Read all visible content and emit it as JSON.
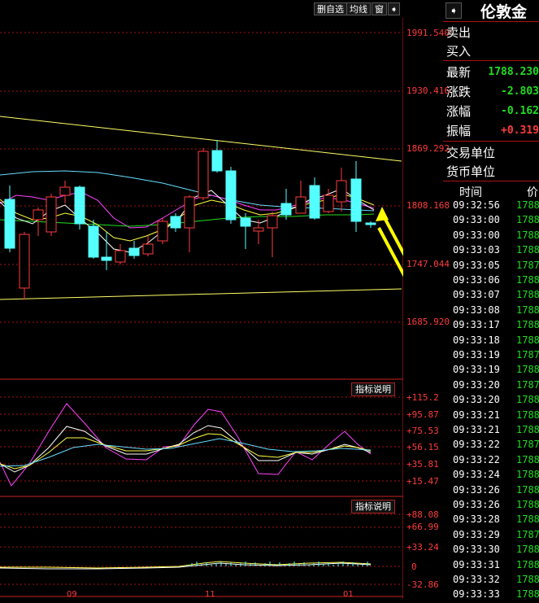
{
  "toolbar": {
    "delete_watch_label": "删自选",
    "ma_label": "均线",
    "window_label": "窗"
  },
  "main_chart": {
    "y_labels": [
      "1991.540",
      "1930.416",
      "1869.292",
      "1808.168",
      "1747.044",
      "1685.920"
    ]
  },
  "indicator1": {
    "button_label": "指标说明",
    "y_labels": [
      "+115.2",
      "+95.87",
      "+75.53",
      "+56.15",
      "+35.81",
      "+15.47"
    ]
  },
  "indicator2": {
    "button_label": "指标说明",
    "y_labels": [
      "+88.08",
      "+66.99",
      "+33.24",
      "0",
      "-32.86"
    ]
  },
  "x_axis": {
    "labels": [
      "09",
      "11",
      "01"
    ]
  },
  "panel": {
    "title": "伦敦金",
    "sell_label": "卖出",
    "buy_label": "买入",
    "latest_label": "最新",
    "latest_value": "1788.230",
    "change_label": "涨跌",
    "change_value": "-2.803",
    "change_pct_label": "涨幅",
    "change_pct_value": "-0.162",
    "amplitude_label": "振幅",
    "amplitude_value": "+0.319",
    "trade_unit_label": "交易单位",
    "currency_unit_label": "货币单位",
    "time_header": "时间",
    "price_header": "价"
  },
  "trades": [
    {
      "time": "09:32:56",
      "price": "1788"
    },
    {
      "time": "09:33:00",
      "price": "1788"
    },
    {
      "time": "09:33:00",
      "price": "1788"
    },
    {
      "time": "09:33:03",
      "price": "1788"
    },
    {
      "time": "09:33:05",
      "price": "1787"
    },
    {
      "time": "09:33:06",
      "price": "1788"
    },
    {
      "time": "09:33:07",
      "price": "1788"
    },
    {
      "time": "09:33:08",
      "price": "1788"
    },
    {
      "time": "09:33:17",
      "price": "1788"
    },
    {
      "time": "09:33:18",
      "price": "1788"
    },
    {
      "time": "09:33:19",
      "price": "1787"
    },
    {
      "time": "09:33:19",
      "price": "1788"
    },
    {
      "time": "09:33:20",
      "price": "1787"
    },
    {
      "time": "09:33:20",
      "price": "1788"
    },
    {
      "time": "09:33:21",
      "price": "1788"
    },
    {
      "time": "09:33:21",
      "price": "1788"
    },
    {
      "time": "09:33:22",
      "price": "1787"
    },
    {
      "time": "09:33:22",
      "price": "1788"
    },
    {
      "time": "09:33:24",
      "price": "1788"
    },
    {
      "time": "09:33:26",
      "price": "1788"
    },
    {
      "time": "09:33:26",
      "price": "1788"
    },
    {
      "time": "09:33:28",
      "price": "1788"
    },
    {
      "time": "09:33:29",
      "price": "1787"
    },
    {
      "time": "09:33:30",
      "price": "1788"
    },
    {
      "time": "09:33:31",
      "price": "1788"
    },
    {
      "time": "09:33:32",
      "price": "1788"
    },
    {
      "time": "09:33:33",
      "price": "1788"
    }
  ],
  "colors": {
    "up_candle": "#ff3b3b",
    "down_candle": "#54ffff",
    "grid_red": "#aa1111",
    "trend_line": "#ffff66",
    "annotation_arrow": "#ffff00",
    "ma_white": "#ffffff",
    "ma_yellow": "#ffff44",
    "ma_magenta": "#ff44ff",
    "ma_green": "#22dd22",
    "ma_cyan": "#66ddff",
    "panel_positive": "#ff3b3b",
    "panel_negative": "#22dd22"
  }
}
